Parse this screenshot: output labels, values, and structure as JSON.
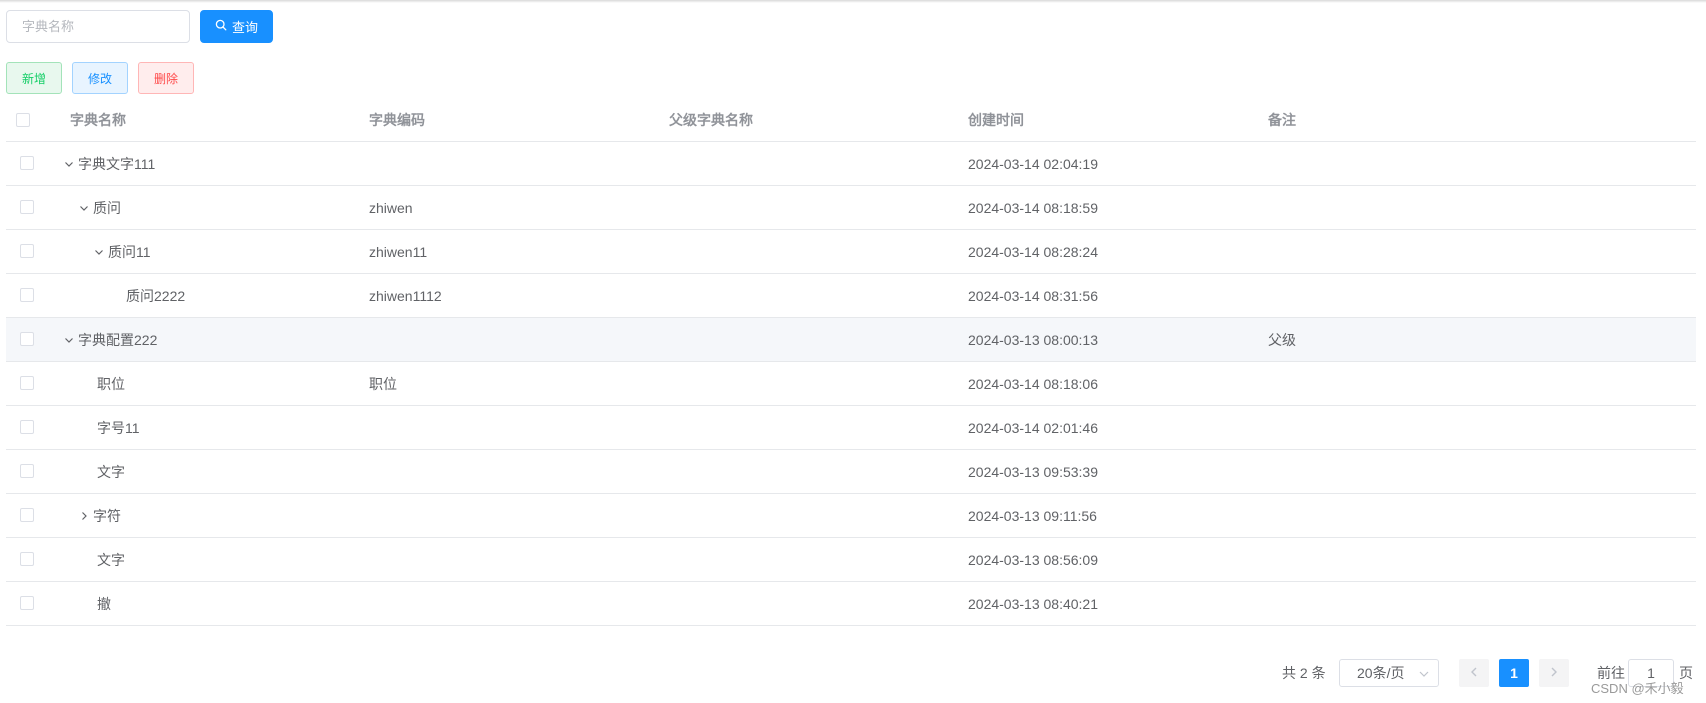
{
  "search": {
    "placeholder": "字典名称",
    "query_label": "查询"
  },
  "actions": {
    "add_label": "新增",
    "edit_label": "修改",
    "delete_label": "删除"
  },
  "table": {
    "headers": {
      "name": "字典名称",
      "code": "字典编码",
      "parent": "父级字典名称",
      "created": "创建时间",
      "remark": "备注"
    },
    "rows": [
      {
        "name": "字典文字111",
        "code": "",
        "parent": "",
        "created": "2024-03-14 02:04:19",
        "remark": "",
        "level": 0,
        "expand": "down"
      },
      {
        "name": "质问",
        "code": "zhiwen",
        "parent": "",
        "created": "2024-03-14 08:18:59",
        "remark": "",
        "level": 1,
        "expand": "down"
      },
      {
        "name": "质问11",
        "code": "zhiwen11",
        "parent": "",
        "created": "2024-03-14 08:28:24",
        "remark": "",
        "level": 2,
        "expand": "down"
      },
      {
        "name": "质问2222",
        "code": "zhiwen1112",
        "parent": "",
        "created": "2024-03-14 08:31:56",
        "remark": "",
        "level": 3,
        "expand": "none"
      },
      {
        "name": "字典配置222",
        "code": "",
        "parent": "",
        "created": "2024-03-13 08:00:13",
        "remark": "父级",
        "level": 0,
        "expand": "down",
        "hover": true
      },
      {
        "name": "职位",
        "code": "职位",
        "parent": "",
        "created": "2024-03-14 08:18:06",
        "remark": "",
        "level": 1,
        "expand": "none"
      },
      {
        "name": "字号11",
        "code": "",
        "parent": "",
        "created": "2024-03-14 02:01:46",
        "remark": "",
        "level": 1,
        "expand": "none"
      },
      {
        "name": "文字",
        "code": "",
        "parent": "",
        "created": "2024-03-13 09:53:39",
        "remark": "",
        "level": 1,
        "expand": "none"
      },
      {
        "name": "字符",
        "code": "",
        "parent": "",
        "created": "2024-03-13 09:11:56",
        "remark": "",
        "level": 1,
        "expand": "right"
      },
      {
        "name": "文字",
        "code": "",
        "parent": "",
        "created": "2024-03-13 08:56:09",
        "remark": "",
        "level": 1,
        "expand": "none"
      },
      {
        "name": "撤",
        "code": "",
        "parent": "",
        "created": "2024-03-13 08:40:21",
        "remark": "",
        "level": 1,
        "expand": "none"
      }
    ]
  },
  "pagination": {
    "total_label": "共 2 条",
    "page_size_label": "20条/页",
    "current_page": "1",
    "goto_label": "前往",
    "goto_value": "1",
    "page_suffix": "页"
  },
  "watermark": "CSDN @禾小毅",
  "colors": {
    "primary": "#1890ff",
    "success": "#13ce66",
    "danger": "#ff4949"
  }
}
